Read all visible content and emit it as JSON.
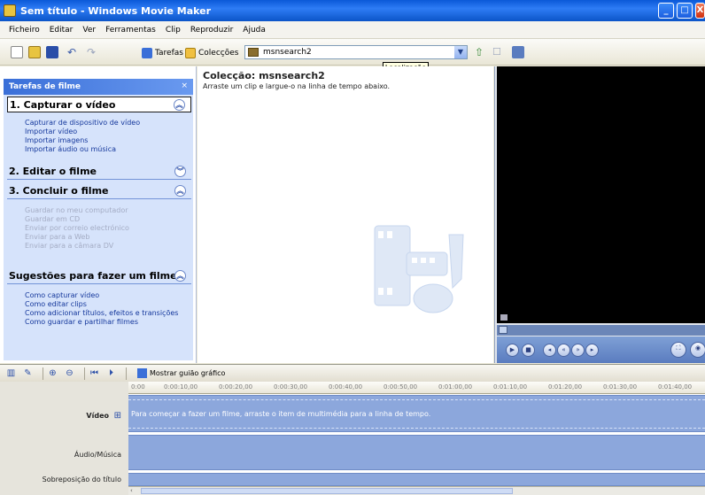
{
  "window": {
    "title": "Sem título - Windows Movie Maker",
    "buttons": [
      "_",
      "□",
      "X"
    ]
  },
  "menu": [
    "Ficheiro",
    "Editar",
    "Ver",
    "Ferramentas",
    "Clip",
    "Reproduzir",
    "Ajuda"
  ],
  "toolbar": {
    "tasks_label": "Tarefas",
    "collections_label": "Colecções",
    "location_value": "msnsearch2",
    "tooltip": "Localização"
  },
  "taskpane": {
    "header": "Tarefas de filme",
    "close": "×",
    "sections": [
      {
        "title": "1. Capturar o vídeo",
        "links": [
          "Capturar de dispositivo de vídeo",
          "Importar vídeo",
          "Importar imagens",
          "Importar áudio ou música"
        ]
      },
      {
        "title": "2. Editar o filme",
        "links": []
      },
      {
        "title": "3. Concluir o filme",
        "links": [
          "Guardar no meu computador",
          "Guardar em CD",
          "Enviar por correio electrónico",
          "Enviar para a Web",
          "Enviar para a câmara DV"
        ]
      },
      {
        "title": "Sugestões para fazer um filme",
        "links": [
          "Como capturar vídeo",
          "Como editar clips",
          "Como adicionar títulos, efeitos e transições",
          "Como guardar e partilhar filmes"
        ]
      }
    ]
  },
  "collection": {
    "title": "Colecção: msnsearch2",
    "subtitle": "Arraste um clip e largue-o na linha de tempo abaixo."
  },
  "storyboard": {
    "show_label": "Mostrar guião gráfico",
    "ticks": [
      "0:00",
      "0:00:10,00",
      "0:00:20,00",
      "0:00:30,00",
      "0:00:40,00",
      "0:00:50,00",
      "0:01:00,00",
      "0:01:10,00",
      "0:01:20,00",
      "0:01:30,00",
      "0:01:40,00"
    ],
    "tracks": {
      "video": "Vídeo",
      "video_expand": "⊞",
      "video_hint": "Para começar a fazer um filme, arraste o item de multimédia para a linha de tempo.",
      "audio": "Áudio/Música",
      "title_overlay": "Sobreposição do título"
    }
  }
}
